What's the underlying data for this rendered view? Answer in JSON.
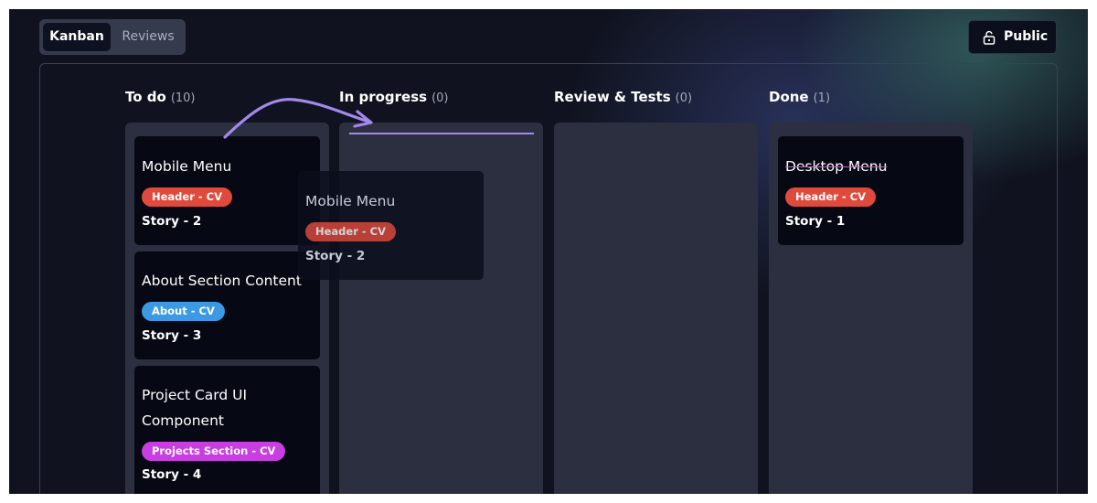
{
  "tabs": [
    {
      "label": "Kanban",
      "active": true
    },
    {
      "label": "Reviews",
      "active": false
    }
  ],
  "public_button": {
    "label": "Public",
    "icon": "unlock-icon"
  },
  "columns": [
    {
      "title": "To do",
      "count": "(10)",
      "cards": [
        {
          "title": "Mobile Menu",
          "tag": "Header - CV",
          "tag_color": "#e04a3c",
          "story": "Story - 2"
        },
        {
          "title": "About Section Content",
          "tag": "About - CV",
          "tag_color": "#3b9ae3",
          "story": "Story - 3"
        },
        {
          "title": "Project Card UI Component",
          "tag": "Projects Section - CV",
          "tag_color": "#c83ee0",
          "story": "Story - 4"
        }
      ]
    },
    {
      "title": "In progress",
      "count": "(0)",
      "cards": []
    },
    {
      "title": "Review & Tests",
      "count": "(0)",
      "cards": []
    },
    {
      "title": "Done",
      "count": "(1)",
      "cards": [
        {
          "title": "Desktop Menu",
          "tag": "Header - CV",
          "tag_color": "#e04a3c",
          "story": "Story - 1",
          "completed": true
        }
      ]
    }
  ],
  "dragging_card": {
    "title": "Mobile Menu",
    "tag": "Header - CV",
    "tag_color": "#e04a3c",
    "story": "Story - 2"
  },
  "colors": {
    "accent": "#a388ee",
    "background": "#10131f",
    "column": "#2b2f40",
    "card": "#060913"
  }
}
